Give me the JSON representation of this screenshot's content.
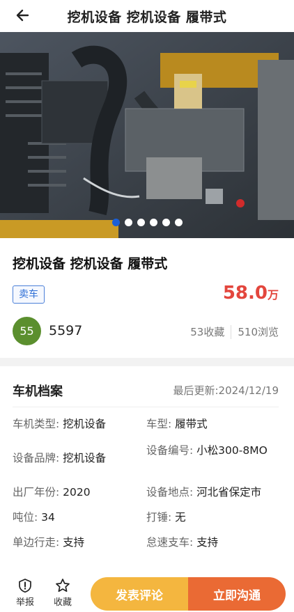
{
  "header": {
    "title": "挖机设备 挖机设备 履带式",
    "back_icon": "arrow-left-icon"
  },
  "gallery": {
    "image_count": 6,
    "active_index": 0
  },
  "listing": {
    "title": "挖机设备 挖机设备 履带式",
    "tag": "卖车",
    "price_value": "58.0",
    "price_unit": "万",
    "seller_avatar_text": "55",
    "seller_name": "5597",
    "favorites": "53收藏",
    "views": "510浏览",
    "price_color": "#e3463d",
    "avatar_color": "#5b8f2e"
  },
  "details": {
    "section_title": "车机档案",
    "updated": "最后更新:2024/12/19",
    "specs": [
      {
        "key": "车机类型:",
        "value": "挖机设备"
      },
      {
        "key": "车型:",
        "value": "履带式"
      },
      {
        "key": "设备品牌:",
        "value": "挖机设备"
      },
      {
        "key": "设备编号:",
        "value": "小松300-8MO"
      },
      {
        "key": "出厂年份:",
        "value": "2020"
      },
      {
        "key": "设备地点:",
        "value": "河北省保定市"
      },
      {
        "key": "吨位:",
        "value": "34"
      },
      {
        "key": "打锤:",
        "value": "无"
      },
      {
        "key": "单边行走:",
        "value": "支持"
      },
      {
        "key": "怠速支车:",
        "value": "支持"
      }
    ]
  },
  "bottom_bar": {
    "report_label": "举报",
    "favorite_label": "收藏",
    "comment_button": "发表评论",
    "contact_button": "立即沟通",
    "comment_color": "#f4b63f",
    "contact_color": "#ea6a34"
  }
}
